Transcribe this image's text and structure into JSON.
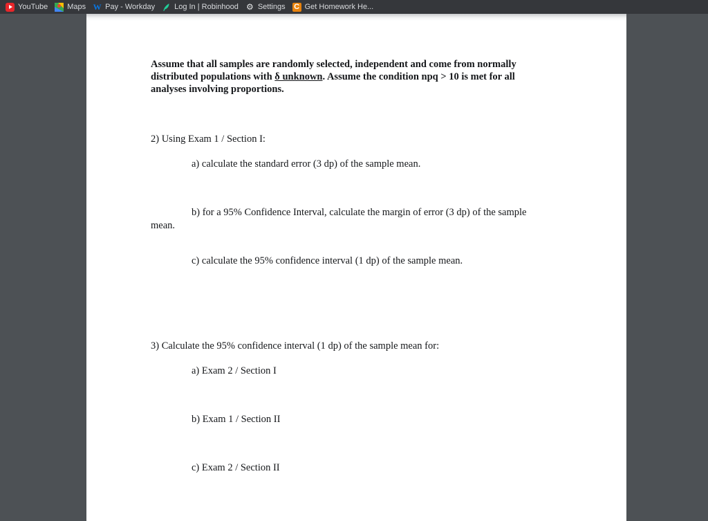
{
  "browser": {
    "bookmarks": [
      {
        "label": "YouTube",
        "icon": "youtube-icon"
      },
      {
        "label": "Maps",
        "icon": "google-maps-icon"
      },
      {
        "label": "Pay - Workday",
        "icon": "workday-icon",
        "icon_text": "W"
      },
      {
        "label": "Log In | Robinhood",
        "icon": "robinhood-feather-icon"
      },
      {
        "label": "Settings",
        "icon": "gear-icon",
        "icon_text": "⚙"
      },
      {
        "label": "Get Homework He...",
        "icon": "chegg-icon",
        "icon_text": "C"
      }
    ]
  },
  "document": {
    "intro": {
      "part1": "Assume that all samples are randomly selected, independent and come from normally distributed populations with ",
      "underlined": "δ unknown",
      "part2": ".  Assume the condition npq > 10 is met for all analyses involving proportions."
    },
    "questions": [
      {
        "number": "2)  Using Exam 1 / Section I:",
        "parts": [
          {
            "label": "a)  calculate the standard error (3 dp) of the sample mean."
          },
          {
            "label": "b)  for a 95% Confidence Interval, calculate the margin of error (3 dp) of the sample",
            "continuation": "mean."
          },
          {
            "label": "c)  calculate the 95% confidence interval (1 dp) of the sample mean."
          }
        ]
      },
      {
        "number": "3)  Calculate the 95% confidence interval (1 dp) of the sample mean for:",
        "parts": [
          {
            "label": "a)  Exam 2 / Section I"
          },
          {
            "label": "b)  Exam 1 / Section II"
          },
          {
            "label": "c)  Exam 2 / Section II"
          }
        ]
      }
    ]
  },
  "colors": {
    "toolbar_bg": "#35373b",
    "viewport_bg": "#4d5155",
    "page_bg": "#ffffff",
    "text": "#15171a",
    "youtube_red": "#e8262a",
    "chegg_orange": "#e8820c",
    "robinhood_green": "#21ce99",
    "workday_blue": "#0875e1"
  }
}
